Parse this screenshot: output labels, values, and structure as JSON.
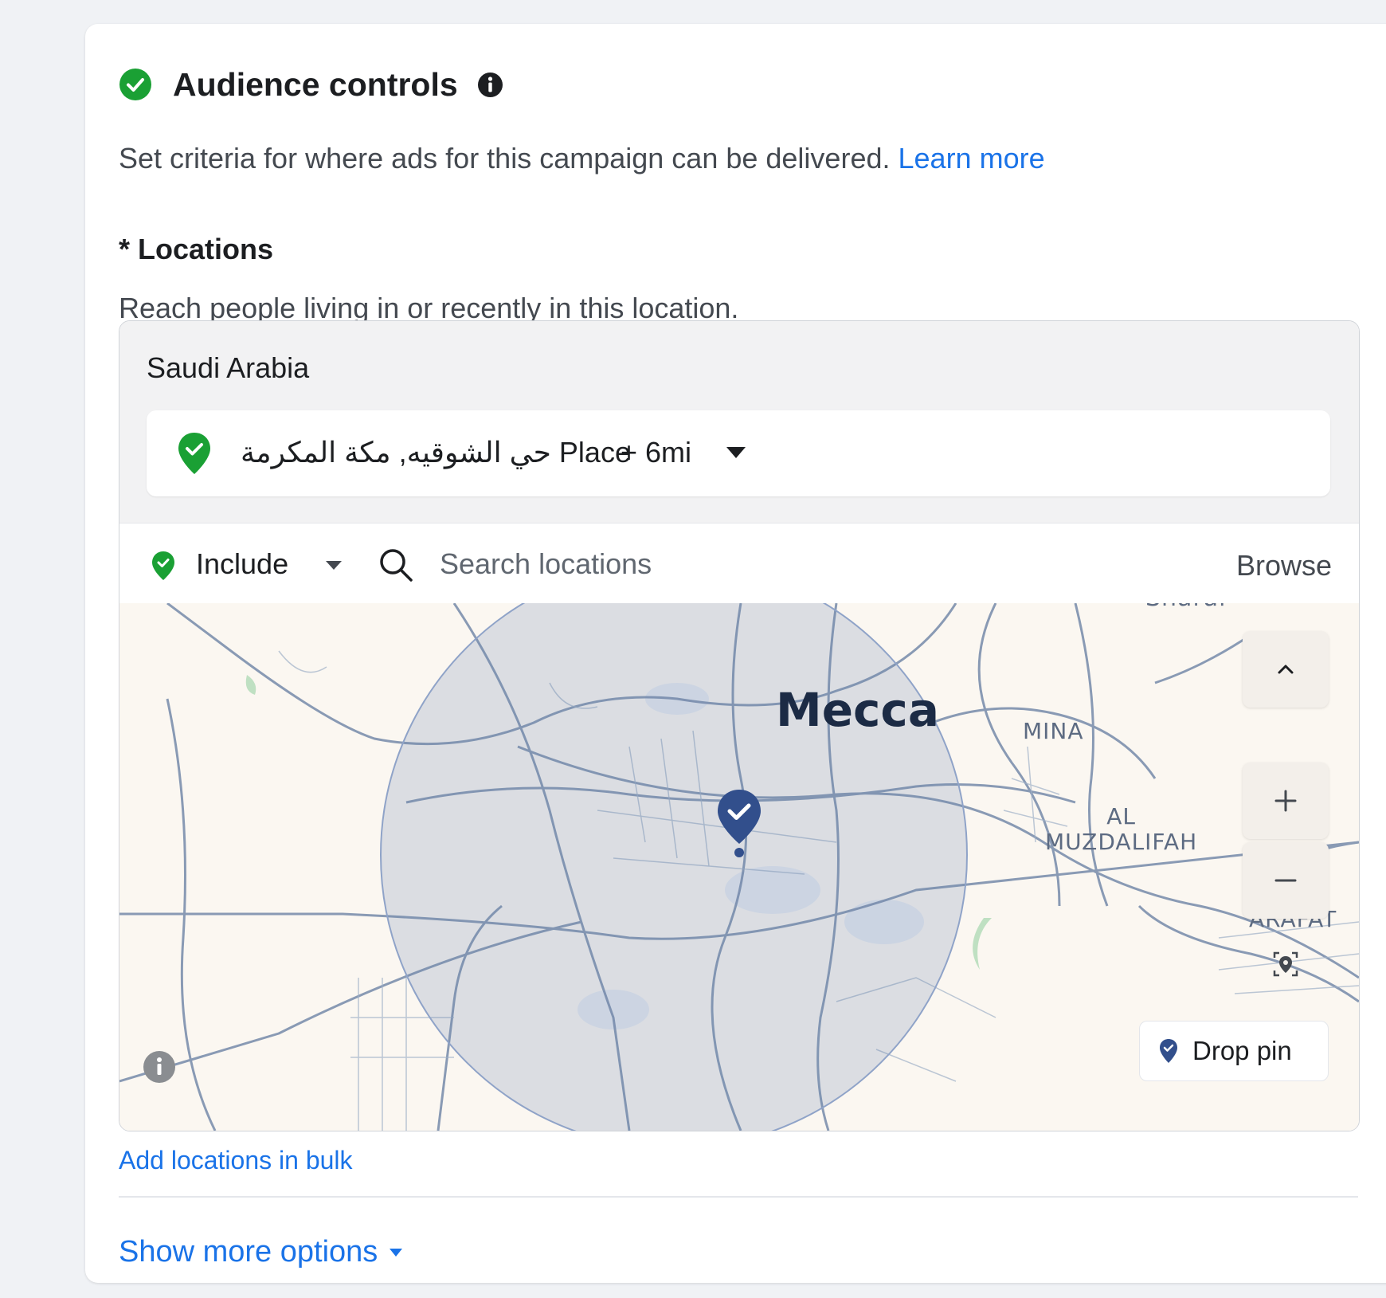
{
  "section": {
    "title": "Audience controls",
    "subtitle": "Set criteria for where ads for this campaign can be delivered.",
    "learn_more": "Learn more",
    "status_icon": "check-circle-icon",
    "info_icon": "info-icon"
  },
  "locations": {
    "label": "* Locations",
    "help": "Reach people living in or recently in this location.",
    "country": "Saudi Arabia",
    "selected": {
      "name": "حي الشوقيه, مكة المكرمة Place",
      "radius": "+ 6mi"
    },
    "mode": "Include",
    "search_placeholder": "Search locations",
    "browse": "Browse"
  },
  "map": {
    "labels": {
      "mecca": "Mecca",
      "sharai": "Sharai",
      "mina": "MINA",
      "muzdalifah_1": "AL",
      "muzdalifah_2": "MUZDALIFAH",
      "arafat": "ARAFAT"
    },
    "drop_pin": "Drop pin",
    "radius_color": "#8fa3c8",
    "marker_color": "#324f8c"
  },
  "footer": {
    "bulk": "Add locations in bulk",
    "show_more": "Show more options"
  },
  "colors": {
    "green": "#1aa034",
    "link": "#1a73e8"
  }
}
